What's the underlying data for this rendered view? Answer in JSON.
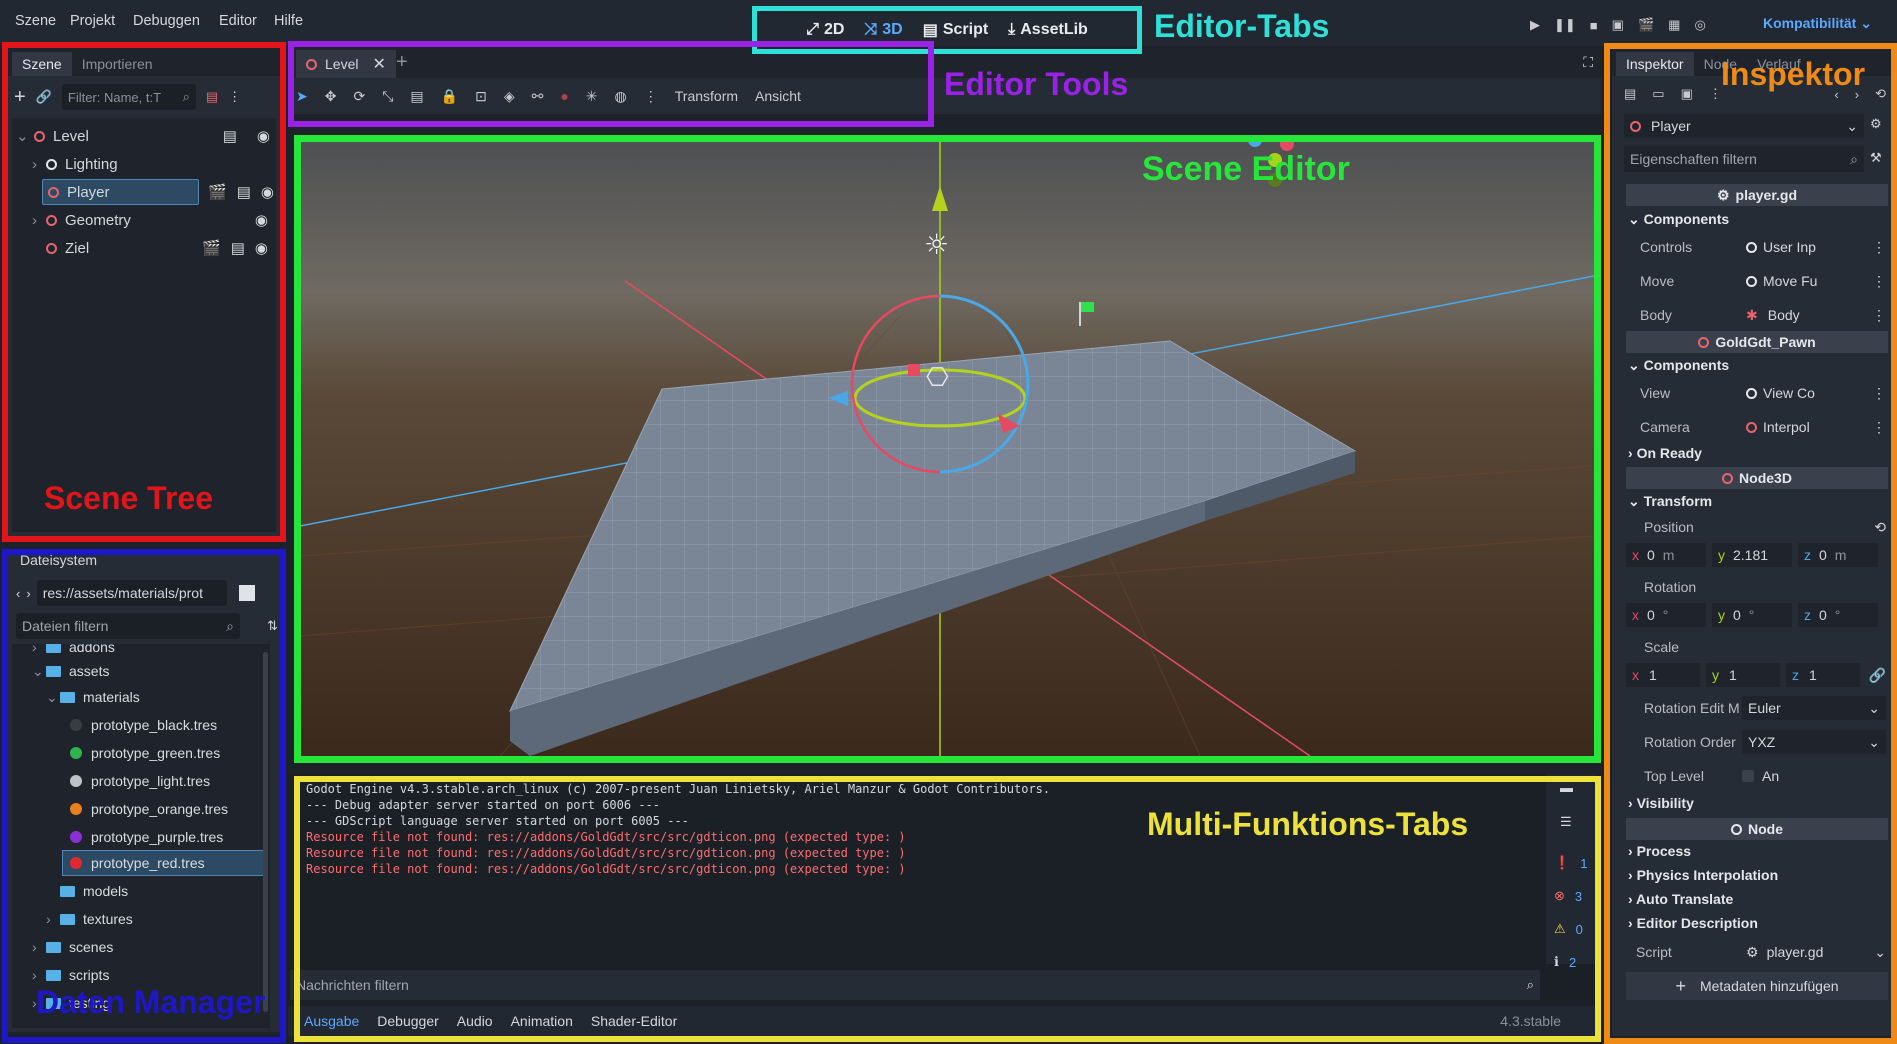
{
  "menu": [
    "Szene",
    "Projekt",
    "Debuggen",
    "Editor",
    "Hilfe"
  ],
  "editor_tabs": {
    "2d": "2D",
    "3d": "3D",
    "script": "Script",
    "assetlib": "AssetLib"
  },
  "compat": "Kompatibilität",
  "annotations": {
    "editor_tabs": "Editor-Tabs",
    "editor_tools": "Editor Tools",
    "inspektor": "Inspektor",
    "scene_editor": "Scene Editor",
    "scene_tree": "Scene Tree",
    "multi": "Multi-Funktions-Tabs",
    "data_manager": "Daten Manager"
  },
  "colors": {
    "red": "#e3141a",
    "blue": "#1f16c9",
    "purple": "#9a22e6",
    "cyan": "#2ee1d8",
    "green": "#27e63a",
    "yellow": "#ece23b",
    "orange": "#f08a17",
    "accent": "#5aa9ff"
  },
  "scene_dock": {
    "tabs": [
      "Szene",
      "Importieren"
    ],
    "filter_placeholder": "Filter: Name, t:T",
    "nodes": [
      "Level",
      "Lighting",
      "Player",
      "Geometry",
      "Ziel"
    ]
  },
  "fs_dock": {
    "title": "Dateisystem",
    "path": "res://assets/materials/prot",
    "filter_placeholder": "Dateien filtern",
    "items": [
      "addons",
      "assets",
      "materials",
      "prototype_black.tres",
      "prototype_green.tres",
      "prototype_light.tres",
      "prototype_orange.tres",
      "prototype_purple.tres",
      "prototype_red.tres",
      "models",
      "textures",
      "scenes",
      "scripts",
      "testing"
    ]
  },
  "viewport": {
    "tab": "Level",
    "menu_transform": "Transform",
    "menu_view": "Ansicht"
  },
  "bottom": {
    "log": [
      "Godot Engine v4.3.stable.arch_linux (c) 2007-present Juan Linietsky, Ariel Manzur & Godot Contributors.",
      "--- Debug adapter server started on port 6006 ---",
      "--- GDScript language server started on port 6005 ---",
      "Resource file not found: res://addons/GoldGdt/src/src/gdticon.png (expected type: )",
      "Resource file not found: res://addons/GoldGdt/src/src/gdticon.png (expected type: )",
      "Resource file not found: res://addons/GoldGdt/src/src/gdticon.png (expected type: )"
    ],
    "filter_placeholder": "Nachrichten filtern",
    "tabs": [
      "Ausgabe",
      "Debugger",
      "Audio",
      "Animation",
      "Shader-Editor"
    ],
    "version": "4.3.stable",
    "counts": [
      "1",
      "3",
      "0",
      "2"
    ]
  },
  "inspector": {
    "tabs": [
      "Inspektor",
      "Node",
      "Verlauf"
    ],
    "node": "Player",
    "filter_placeholder": "Eigenschaften filtern",
    "script_header": "player.gd",
    "components_label": "Components",
    "components1": [
      {
        "k": "Controls",
        "v": "User Inp"
      },
      {
        "k": "Move",
        "v": "Move Fu"
      },
      {
        "k": "Body",
        "v": "Body"
      }
    ],
    "pawn_header": "GoldGdt_Pawn",
    "components2": [
      {
        "k": "View",
        "v": "View Co"
      },
      {
        "k": "Camera",
        "v": "Interpol"
      }
    ],
    "on_ready": "On Ready",
    "node3d_header": "Node3D",
    "transform": "Transform",
    "position_label": "Position",
    "position": {
      "x": "0",
      "y": "2.181",
      "z": "0",
      "unit": "m"
    },
    "rotation_label": "Rotation",
    "rotation": {
      "x": "0",
      "y": "0",
      "z": "0",
      "unit": "°"
    },
    "scale_label": "Scale",
    "scale": {
      "x": "1",
      "y": "1",
      "z": "1"
    },
    "rot_edit_label": "Rotation Edit M",
    "rot_edit_value": "Euler",
    "rot_order_label": "Rotation Order",
    "rot_order_value": "YXZ",
    "top_level_label": "Top Level",
    "top_level_value": "An",
    "visibility": "Visibility",
    "node_header": "Node",
    "sections": [
      "Process",
      "Physics Interpolation",
      "Auto Translate",
      "Editor Description"
    ],
    "script_label": "Script",
    "script_value": "player.gd",
    "add_meta": "Metadaten hinzufügen"
  }
}
